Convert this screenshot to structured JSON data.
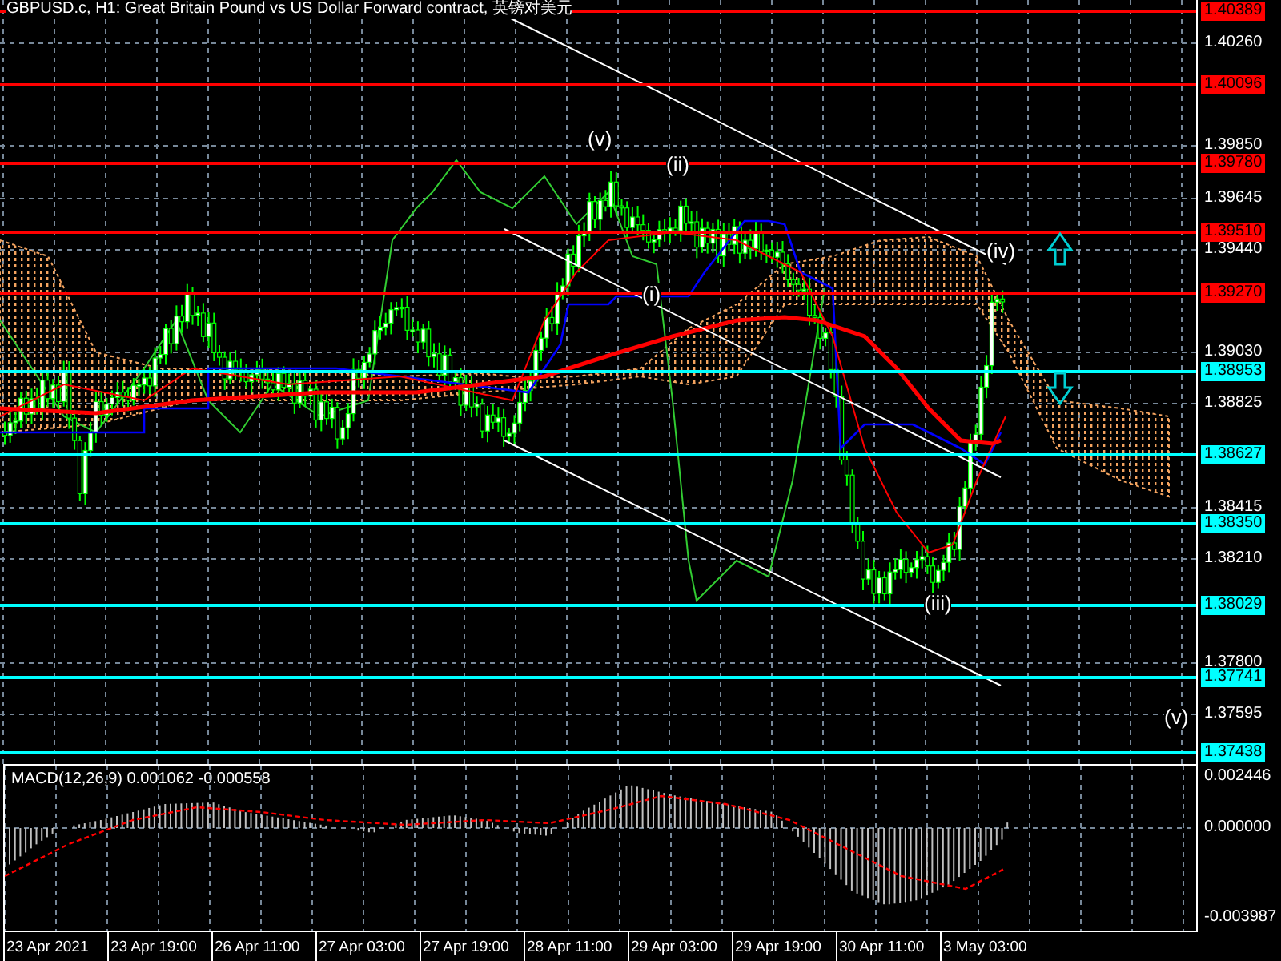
{
  "chart": {
    "title": "GBPUSD.c, H1:  Great Britain Pound vs US Dollar Forward contract, 英镑对美元",
    "wave_labels": [
      "(v)",
      "(ii)",
      "(i)",
      "(iv)",
      "(iii)",
      "(v)"
    ],
    "levels": [
      {
        "price": "1.40389",
        "color": "#ff0000"
      },
      {
        "price": "1.40096",
        "color": "#ff0000"
      },
      {
        "price": "1.39780",
        "color": "#ff0000"
      },
      {
        "price": "1.39510",
        "color": "#ff0000"
      },
      {
        "price": "1.39270",
        "color": "#ff0000"
      },
      {
        "price": "1.38953",
        "color": "#00ffff"
      },
      {
        "price": "1.38627",
        "color": "#00ffff"
      },
      {
        "price": "1.38350",
        "color": "#00ffff"
      },
      {
        "price": "1.38029",
        "color": "#00ffff"
      },
      {
        "price": "1.37741",
        "color": "#00ffff"
      },
      {
        "price": "1.37438",
        "color": "#00ffff"
      }
    ],
    "price_axis": [
      "1.40260",
      "1.39850",
      "1.39645",
      "1.39440",
      "1.39030",
      "1.38825",
      "1.38415",
      "1.38210",
      "1.37800",
      "1.37595"
    ]
  },
  "macd": {
    "label": "MACD(12,26,9) 0.001062 -0.000558",
    "axis": [
      "0.002446",
      "0.000000",
      "-0.003987"
    ]
  },
  "time_axis": [
    "23 Apr 2021",
    "23 Apr 19:00",
    "26 Apr 11:00",
    "27 Apr 03:00",
    "27 Apr 19:00",
    "28 Apr 11:00",
    "29 Apr 03:00",
    "29 Apr 19:00",
    "30 Apr 11:00",
    "3 May 03:00"
  ]
}
